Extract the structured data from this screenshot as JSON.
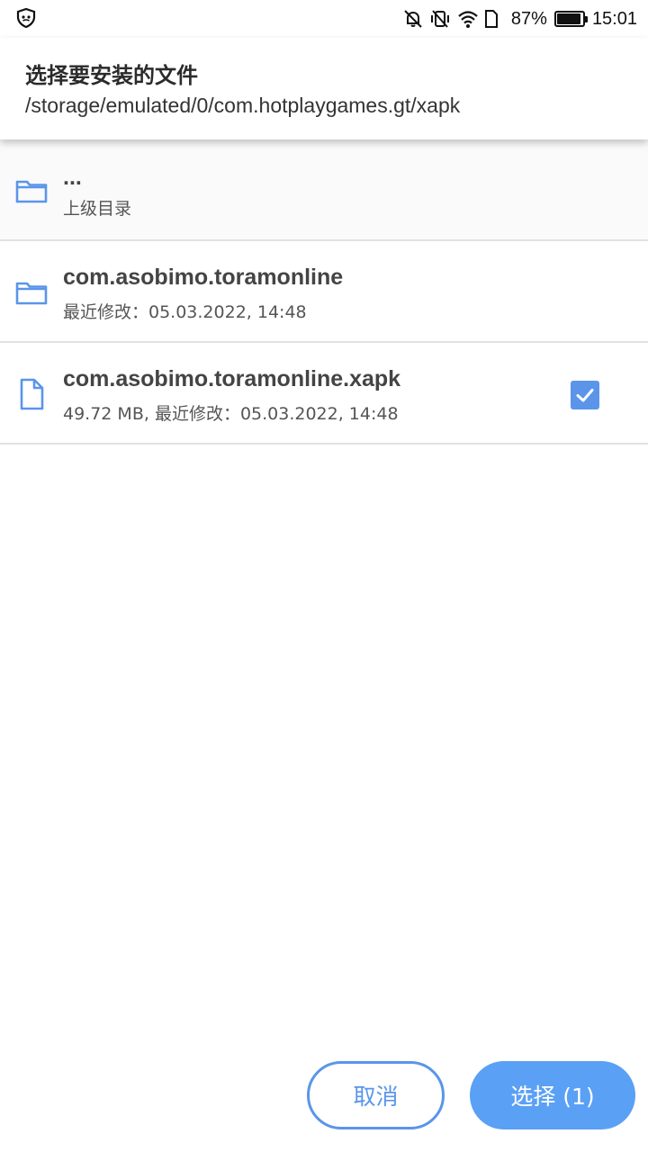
{
  "status_bar": {
    "left_icon": "shield-icon",
    "icons": [
      "mute-icon",
      "vibrate-off-icon",
      "wifi-icon",
      "sim-card-icon"
    ],
    "battery_text": "87%",
    "battery_level": 0.87,
    "time": "15:01"
  },
  "header": {
    "title": "选择要安装的文件",
    "path": "/storage/emulated/0/com.hotplaygames.gt/xapk"
  },
  "rows": [
    {
      "icon": "folder-icon",
      "name": "...",
      "meta": "上级目录"
    },
    {
      "icon": "folder-icon",
      "name": "com.asobimo.toramonline",
      "meta": "最近修改：05.03.2022, 14:48"
    },
    {
      "icon": "file-icon",
      "name": "com.asobimo.toramonline.xapk",
      "meta": "49.72 MB, 最近修改：05.03.2022, 14:48",
      "checked": true
    }
  ],
  "buttons": {
    "cancel_label": "取消",
    "select_label": "选择 (1)"
  },
  "colors": {
    "accent": "#5a95ea",
    "select_button": "#5aa0f5",
    "divider": "#e2e2e2"
  }
}
